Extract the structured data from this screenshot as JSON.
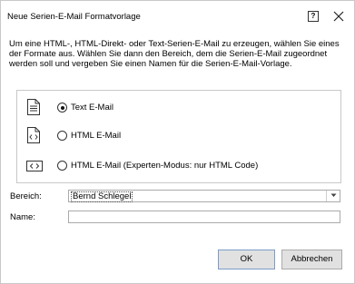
{
  "dialog": {
    "title": "Neue Serien-E-Mail Formatvorlage",
    "help_label": "?",
    "intro": "Um eine HTML-, HTML-Direkt- oder Text-Serien-E-Mail zu erzeugen, wählen Sie eines der Formate aus. Wählen Sie dann den Bereich, dem die Serien-E-Mail zugeordnet werden soll und vergeben Sie einen Namen für die Serien-E-Mail-Vorlage."
  },
  "format_options": [
    {
      "label": "Text E-Mail",
      "icon": "text-document-icon",
      "selected": true
    },
    {
      "label": "HTML E-Mail",
      "icon": "html-document-icon",
      "selected": false
    },
    {
      "label": "HTML E-Mail (Experten-Modus: nur HTML Code)",
      "icon": "html-code-icon",
      "selected": false
    }
  ],
  "form": {
    "bereich_label": "Bereich:",
    "bereich_value": "Bernd Schlegel",
    "name_label": "Name:",
    "name_value": ""
  },
  "buttons": {
    "ok": "OK",
    "cancel": "Abbrechen"
  }
}
